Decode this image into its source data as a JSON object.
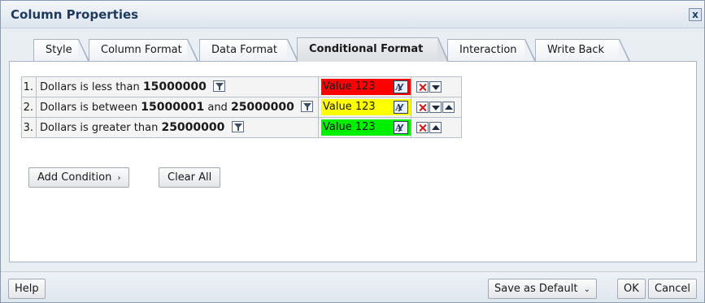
{
  "dialog": {
    "title": "Column Properties",
    "close_glyph": "x"
  },
  "tabs": [
    {
      "label": "Style",
      "active": false
    },
    {
      "label": "Column Format",
      "active": false
    },
    {
      "label": "Data Format",
      "active": false
    },
    {
      "label": "Conditional Format",
      "active": true
    },
    {
      "label": "Interaction",
      "active": false
    },
    {
      "label": "Write Back",
      "active": false
    }
  ],
  "conditions": [
    {
      "num": "1.",
      "text_a": "Dollars is less than ",
      "value_a": "15000000",
      "format_label": "Value 123",
      "format_bg": "#ff0000",
      "format_text": "#000000"
    },
    {
      "num": "2.",
      "text_a": "Dollars is between ",
      "value_a": "15000001",
      "text_b": " and ",
      "value_b": "25000000",
      "format_label": "Value 123",
      "format_bg": "#ffff00",
      "format_text": "#000000"
    },
    {
      "num": "3.",
      "text_a": "Dollars is greater than ",
      "value_a": "25000000",
      "format_label": "Value 123",
      "format_bg": "#00ee00",
      "format_text": "#000000"
    }
  ],
  "buttons": {
    "add_condition": "Add Condition",
    "add_condition_chevron": "›",
    "clear_all": "Clear All"
  },
  "footer": {
    "help": "Help",
    "save_default": "Save as Default",
    "save_default_chevron": "⌄",
    "ok": "OK",
    "cancel": "Cancel"
  },
  "icons": {
    "filter": "filter-icon",
    "edit_format": "edit-format-icon",
    "delete": "delete-icon",
    "move_down": "move-down-icon",
    "move_up": "move-up-icon"
  }
}
